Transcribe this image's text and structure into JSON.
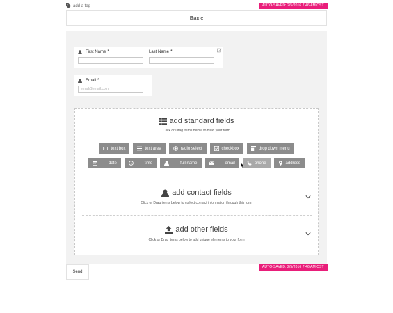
{
  "header": {
    "add_tag_label": "add a tag",
    "autosave_text": "AUTO-SAVED: 2/5/2016 7:46 AM CST"
  },
  "form": {
    "title": "Basic",
    "first_name_label": "First Name",
    "last_name_label": "Last Name",
    "email_label": "Email",
    "email_placeholder": "email@email.com",
    "required_marker": "*"
  },
  "builder": {
    "standard": {
      "title": "add standard fields",
      "subtitle": "Click or Drag items below to build your form",
      "row1": [
        {
          "label": "text box",
          "icon": "text-box-icon"
        },
        {
          "label": "text area",
          "icon": "text-area-icon"
        },
        {
          "label": "radio select",
          "icon": "radio-icon"
        },
        {
          "label": "checkbox",
          "icon": "checkbox-icon"
        },
        {
          "label": "drop down menu",
          "icon": "dropdown-icon"
        }
      ],
      "row2": [
        {
          "label": "date",
          "icon": "calendar-icon"
        },
        {
          "label": "time",
          "icon": "clock-icon"
        },
        {
          "label": "full name",
          "icon": "user-icon"
        },
        {
          "label": "email",
          "icon": "envelope-icon"
        },
        {
          "label": "phone",
          "icon": "phone-icon"
        },
        {
          "label": "address",
          "icon": "map-pin-icon"
        }
      ]
    },
    "contact": {
      "title": "add contact fields",
      "subtitle": "Click or Drag items below to collect contact information through this form"
    },
    "other": {
      "title": "add other fields",
      "subtitle": "Click or Drag items below to add unique elements to your form"
    }
  },
  "footer": {
    "send_label": "Send",
    "autosave_text": "AUTO-SAVED: 2/5/2016 7:46 AM CST"
  },
  "colors": {
    "autosave_badge": "#e91e7a",
    "field_button": "#8c8c8c",
    "canvas_bg": "#f2f2f2"
  }
}
